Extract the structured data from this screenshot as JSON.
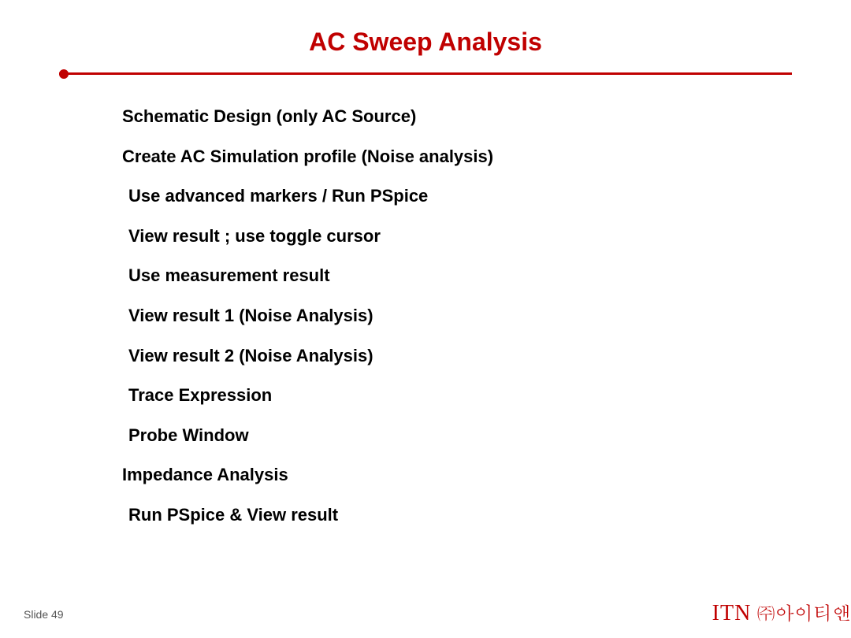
{
  "title": "AC Sweep Analysis",
  "items": [
    {
      "text": "Schematic Design (only AC Source)",
      "indent": 0
    },
    {
      "text": "Create AC Simulation profile (Noise analysis)",
      "indent": 0
    },
    {
      "text": "Use advanced markers / Run PSpice",
      "indent": 1
    },
    {
      "text": "View result ; use toggle cursor",
      "indent": 1
    },
    {
      "text": "Use measurement result",
      "indent": 1
    },
    {
      "text": "View result 1 (Noise Analysis)",
      "indent": 1
    },
    {
      "text": "View result 2 (Noise Analysis)",
      "indent": 1
    },
    {
      "text": "Trace Expression",
      "indent": 1
    },
    {
      "text": "Probe Window",
      "indent": 1
    },
    {
      "text": "Impedance Analysis",
      "indent": 0
    },
    {
      "text": "Run PSpice & View result",
      "indent": 1
    }
  ],
  "footer": {
    "slide_label": "Slide 49",
    "brand_en": "ITN",
    "brand_kr": "㈜아이티앤"
  }
}
